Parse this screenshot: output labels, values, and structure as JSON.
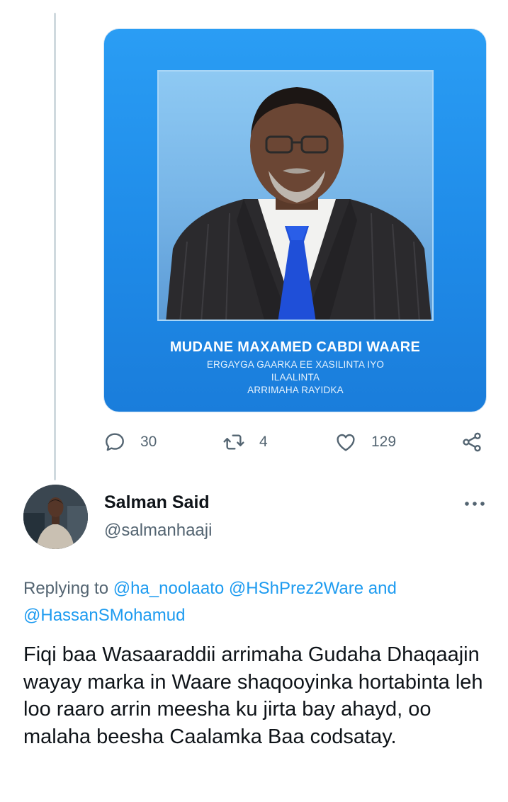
{
  "media": {
    "caption_name": "MUDANE MAXAMED CABDI WAARE",
    "caption_title_line1": "ERGAYGA GAARKA EE XASILINTA IYO ILAALINTA",
    "caption_title_line2": "ARRIMAHA RAYIDKA"
  },
  "actions": {
    "replies": "30",
    "retweets": "4",
    "likes": "129",
    "icons": [
      "reply-icon",
      "retweet-icon",
      "like-icon",
      "share-icon"
    ]
  },
  "reply": {
    "display_name": "Salman Said",
    "handle": "@salmanhaaji",
    "replying_prefix": "Replying to",
    "mention_1": "@ha_noolaato",
    "mention_2": "@HShPrez2Ware",
    "conjunction": "and",
    "mention_3": "@HassanSMohamud",
    "text": "Fiqi baa Wasaaraddii arrimaha Gudaha Dhaqaajin wayay marka in Waare shaqooyinka hortabinta leh loo raaro arrin meesha ku jirta bay ahayd, oo malaha beesha Caalamka Baa codsatay."
  },
  "colors": {
    "accent": "#1d9bf0",
    "muted": "#536471",
    "text": "#0f1419",
    "card_blue": "#1f8be8"
  }
}
